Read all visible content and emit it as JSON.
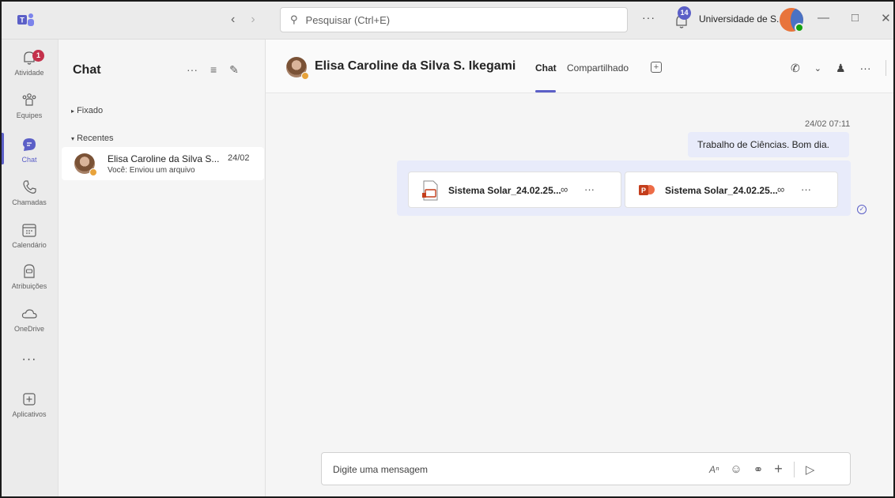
{
  "titlebar": {
    "search_placeholder": "Pesquisar (Ctrl+E)",
    "notification_count": "14",
    "org_name": "Universidade de S..."
  },
  "rail": {
    "activity_badge": "1",
    "items": [
      {
        "label": "Atividade",
        "icon": "bell-icon"
      },
      {
        "label": "Equipes",
        "icon": "teams-icon"
      },
      {
        "label": "Chat",
        "icon": "chat-icon"
      },
      {
        "label": "Chamadas",
        "icon": "phone-icon"
      },
      {
        "label": "Calendário",
        "icon": "calendar-icon"
      },
      {
        "label": "Atribuições",
        "icon": "assignments-icon"
      },
      {
        "label": "OneDrive",
        "icon": "cloud-icon"
      },
      {
        "label": "Aplicativos",
        "icon": "apps-icon"
      }
    ]
  },
  "list": {
    "title": "Chat",
    "pinned_label": "Fixado",
    "recent_label": "Recentes",
    "chat_items": [
      {
        "name": "Elisa Caroline da Silva S...",
        "date": "24/02",
        "preview": "Você: Enviou um arquivo"
      }
    ]
  },
  "conversation": {
    "contact_name": "Elisa Caroline da Silva S. Ikegami",
    "tabs": [
      {
        "label": "Chat",
        "active": true
      },
      {
        "label": "Compartilhado",
        "active": false
      }
    ],
    "messages": {
      "timestamp": "24/02 07:11",
      "text": "Trabalho de Ciências. Bom dia.",
      "files": [
        {
          "name": "Sistema Solar_24.02.25...",
          "type": "presentation-outline"
        },
        {
          "name": "Sistema Solar_24.02.25...",
          "type": "powerpoint"
        }
      ]
    },
    "composer_placeholder": "Digite uma mensagem"
  },
  "colors": {
    "accent": "#5b5fc7",
    "bubble": "#e8ebfa",
    "activity_badge": "#c4314b",
    "presence_away": "#e8a33b",
    "presence_available": "#13a10e",
    "powerpoint": "#c43e1c"
  }
}
